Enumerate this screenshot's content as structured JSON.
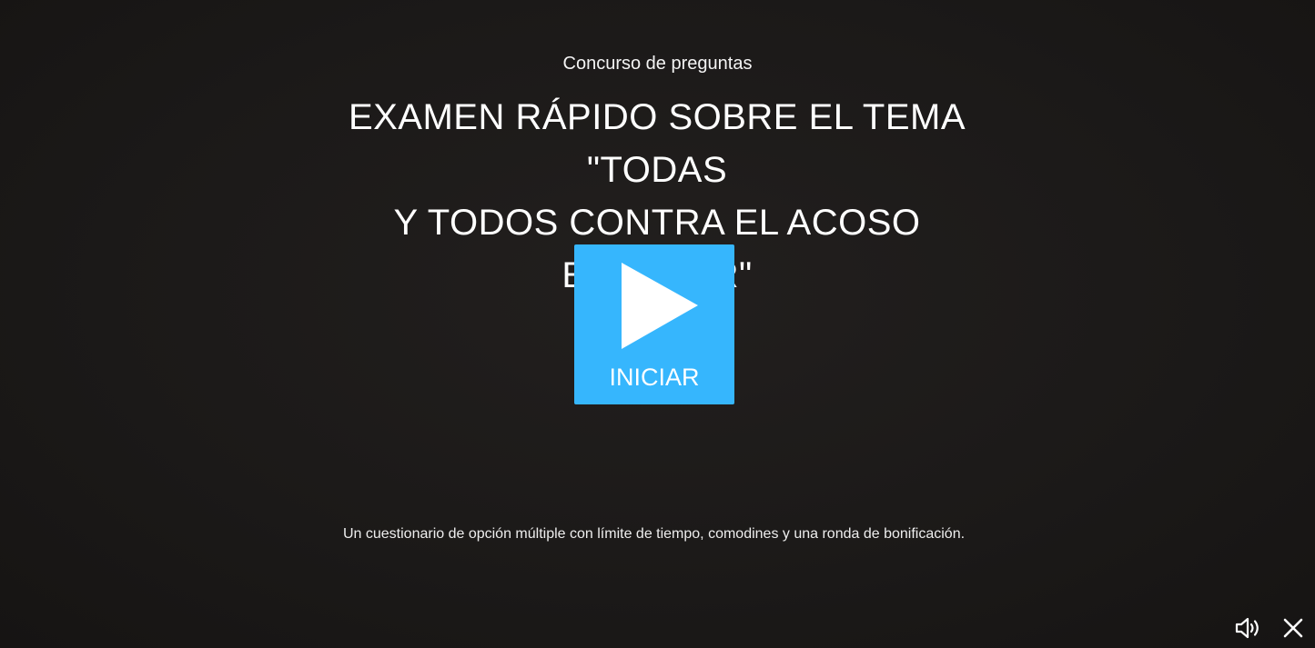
{
  "quiz": {
    "kicker": "Concurso de preguntas",
    "title_line1": "EXAMEN RÁPIDO SOBRE EL TEMA \"TODAS",
    "title_line2": "Y TODOS CONTRA EL ACOSO ESCOLAR\"",
    "start_label": "INICIAR",
    "start_icon": "play-icon",
    "description": "Un cuestionario de opción múltiple con límite de tiempo, comodines y una ronda de bonificación."
  },
  "controls": {
    "volume_icon": "volume-icon",
    "close_icon": "close-icon"
  },
  "colors": {
    "background": "#1b1918",
    "accent": "#36b6fd",
    "text": "#ffffff"
  }
}
